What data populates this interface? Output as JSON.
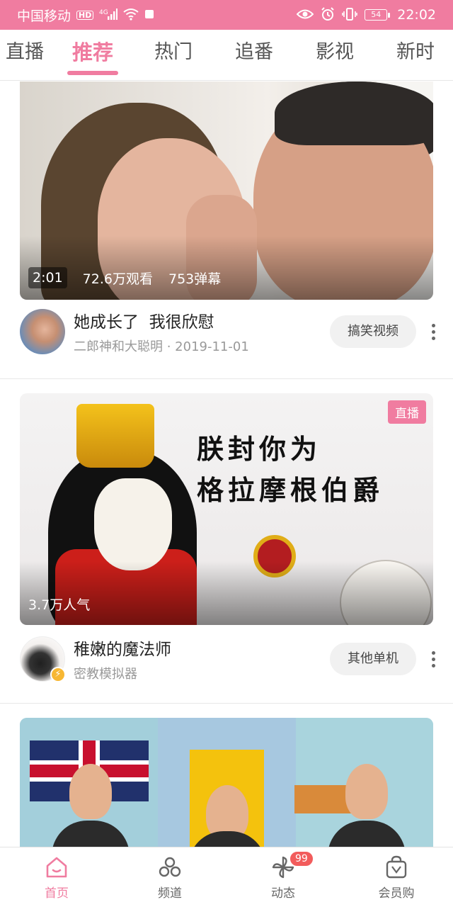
{
  "status_bar": {
    "carrier": "中国移动",
    "hd": "HD",
    "network": "4G",
    "battery": "54",
    "time": "22:02"
  },
  "tabs": [
    "直播",
    "推荐",
    "热门",
    "追番",
    "影视",
    "新时"
  ],
  "active_tab_index": 1,
  "cards": [
    {
      "duration": "2:01",
      "views": "72.6万观看",
      "danmaku": "753弹幕",
      "title": "她成长了  我很欣慰",
      "subtitle": "二郎神和大聪明 · 2019-11-01",
      "tag": "搞笑视频"
    },
    {
      "live_badge": "直播",
      "popularity": "3.7万人气",
      "meme_line1": "朕封你为",
      "meme_line2": "格拉摩根伯爵",
      "title": "稚嫩的魔法师",
      "subtitle": "密教模拟器",
      "tag": "其他单机"
    }
  ],
  "bottom_nav": {
    "items": [
      "首页",
      "频道",
      "动态",
      "会员购"
    ],
    "active_index": 0,
    "dynamic_badge": "99"
  },
  "colors": {
    "accent": "#f07ca0",
    "badge_red": "#f25c5c"
  },
  "icons": {
    "home": "home-icon",
    "channel": "channel-icon",
    "dynamic": "pinwheel-icon",
    "shop": "shopping-bag-icon",
    "more": "more-vertical-icon"
  }
}
